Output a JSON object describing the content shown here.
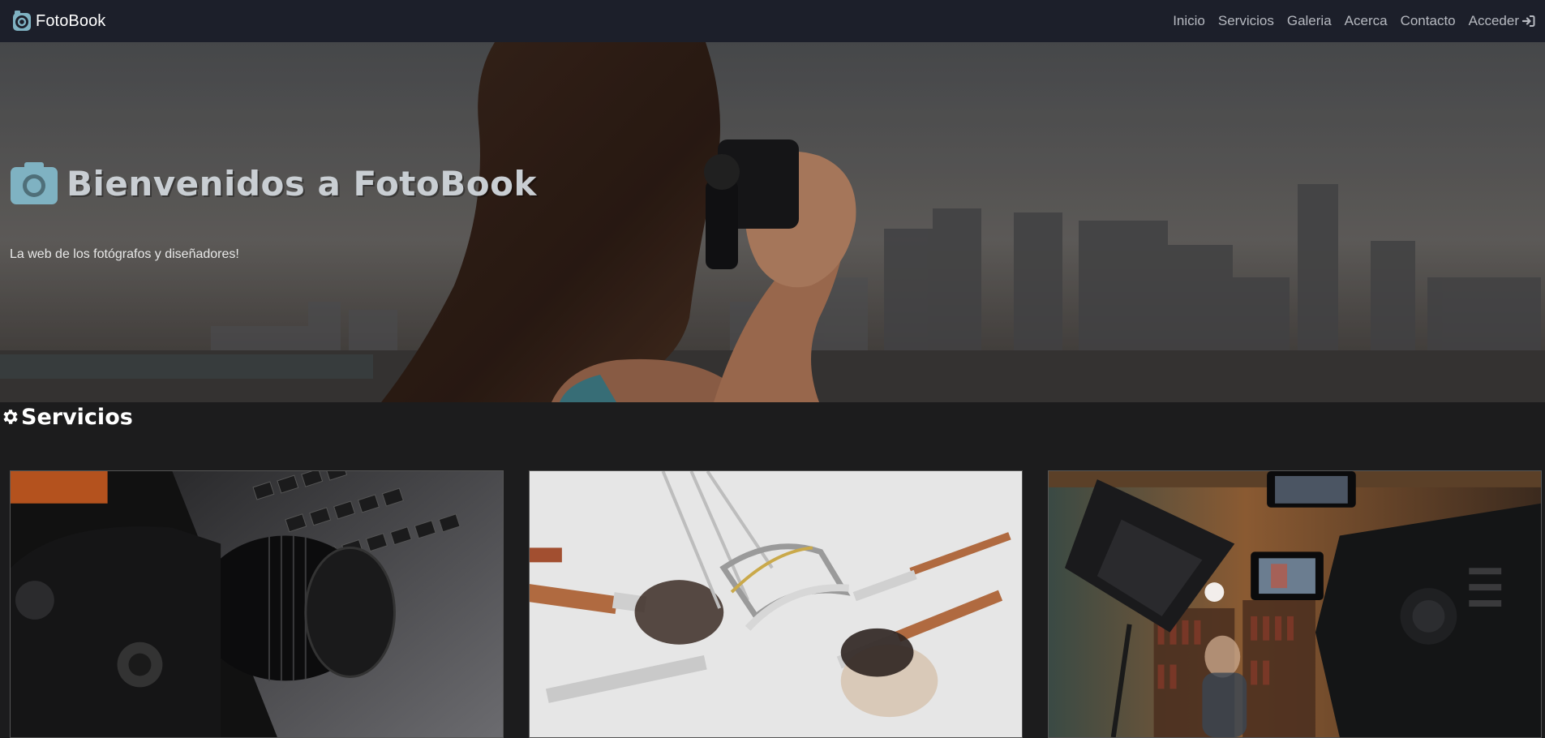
{
  "brand": {
    "name": "FotoBook",
    "logo_icon": "camera-logo-icon"
  },
  "nav": {
    "links": [
      {
        "label": "Inicio"
      },
      {
        "label": "Servicios"
      },
      {
        "label": "Galeria"
      },
      {
        "label": "Acerca"
      },
      {
        "label": "Contacto"
      },
      {
        "label": "Acceder",
        "icon": "sign-in-icon"
      }
    ]
  },
  "hero": {
    "icon": "camera-icon",
    "title": "Bienvenidos a FotoBook",
    "subtitle": "La web de los fotógrafos y diseñadores!"
  },
  "services": {
    "icon": "gear-icon",
    "heading": "Servicios",
    "cards": [
      {
        "image": "camera-laptop-photo"
      },
      {
        "image": "makeup-brushes-photo"
      },
      {
        "image": "video-studio-photo"
      }
    ]
  },
  "colors": {
    "navbar_bg": "#1c1f2a",
    "page_bg": "#1c1c1d",
    "accent": "#7fb2c2",
    "nav_link": "#b6b9c0"
  }
}
